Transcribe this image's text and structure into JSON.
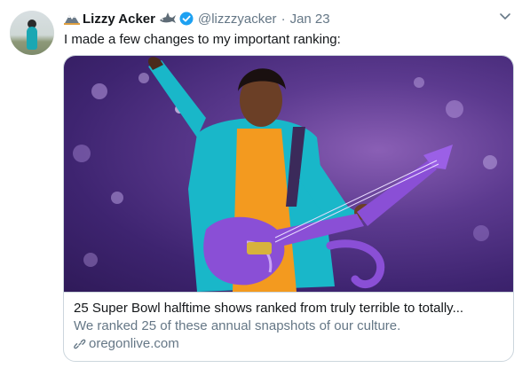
{
  "tweet": {
    "author_name": "Lizzy Acker",
    "handle": "@lizzzyacker",
    "separator": "·",
    "date": "Jan 23",
    "text": "I made a few changes to my important ranking:"
  },
  "card": {
    "title": "25 Super Bowl halftime shows ranked from truly terrible to totally...",
    "description": "We ranked 25 of these annual snapshots of our culture.",
    "domain": "oregonlive.com"
  },
  "colors": {
    "name": "#14171a",
    "meta": "#657786",
    "verified": "#1da1f2",
    "border": "#ccd6dd",
    "stage": "#4a2b80",
    "jacket": "#19b7c9",
    "shirt": "#f39a1f",
    "guitar": "#8a4fd6"
  },
  "icons": [
    "mountain-icon",
    "shark-icon",
    "verified-icon",
    "caret-down-icon",
    "link-icon"
  ]
}
